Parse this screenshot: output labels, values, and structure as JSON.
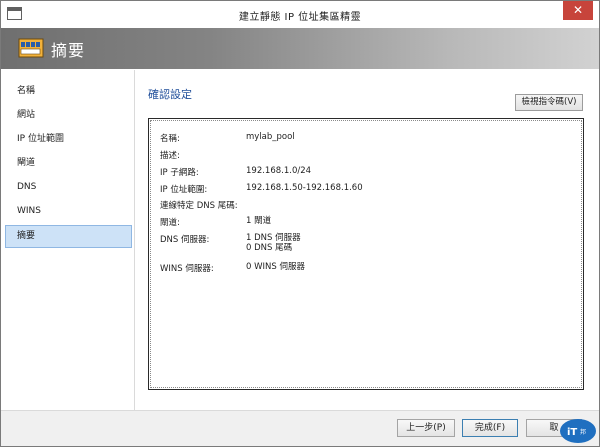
{
  "window": {
    "title": "建立靜態 IP 位址集區精靈"
  },
  "banner": {
    "title": "摘要",
    "icon": "ip-pool-icon"
  },
  "sidebar": {
    "items": [
      {
        "label": "名稱"
      },
      {
        "label": "網站"
      },
      {
        "label": "IP 位址範圍"
      },
      {
        "label": "閘道"
      },
      {
        "label": "DNS"
      },
      {
        "label": "WINS"
      },
      {
        "label": "摘要",
        "active": true
      }
    ]
  },
  "main": {
    "section_title": "確認設定",
    "view_script_label": "檢視指令碼(V)",
    "summary": [
      {
        "key": "名稱:",
        "value": "mylab_pool"
      },
      {
        "key": "描述:",
        "value": ""
      },
      {
        "key": "IP 子網路:",
        "value": "192.168.1.0/24"
      },
      {
        "key": "IP 位址範圍:",
        "value": "192.168.1.50-192.168.1.60"
      },
      {
        "key": "連線特定 DNS 尾碼:",
        "value": ""
      },
      {
        "key": "閘道:",
        "value": "1 閘道"
      },
      {
        "key": "DNS 伺服器:",
        "value": "1 DNS 伺服器",
        "value2": "0 DNS 尾碼"
      },
      {
        "key": "WINS 伺服器:",
        "value": "0 WINS 伺服器"
      }
    ]
  },
  "footer": {
    "prev_label": "上一步(P)",
    "finish_label": "完成(F)",
    "cancel_label": "取"
  },
  "colors": {
    "accent": "#1f4e9a",
    "close": "#c7443b",
    "selected": "#cde2f7"
  }
}
